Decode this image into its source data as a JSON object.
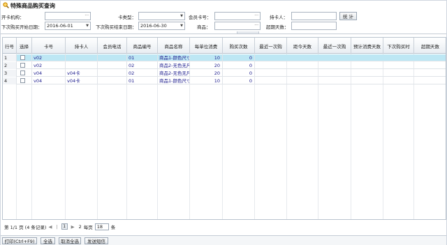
{
  "window": {
    "title": "特殊商品购买查询"
  },
  "filters": {
    "row1": [
      {
        "label": "开卡机构：",
        "value": ""
      },
      {
        "label": "卡类型：",
        "value": ""
      },
      {
        "label": "会员卡号：",
        "value": ""
      },
      {
        "label": "持卡人：",
        "value": ""
      }
    ],
    "row2": [
      {
        "label": "下次购买开始日期：",
        "value": "2016-06-01"
      },
      {
        "label": "下次购买结束日期：",
        "value": "2016-06-30"
      },
      {
        "label": "商品：",
        "value": ""
      },
      {
        "label": "超期天数：",
        "value": ""
      }
    ],
    "stat_button": "统 计"
  },
  "table": {
    "columns": [
      "行号",
      "选择",
      "卡号",
      "持卡人",
      "会员电话",
      "商品编号",
      "商品名称",
      "每单位消费",
      "购买次数",
      "最近一次购",
      "距今天数",
      "最近一次购",
      "预计消费天数",
      "下次购买时",
      "超期天数"
    ],
    "rows": [
      {
        "rn": "1",
        "card": "v02",
        "holder": "",
        "phone": "",
        "code": "01",
        "name": "商品1-颜色尺寸",
        "unit": "10",
        "times": "0"
      },
      {
        "rn": "2",
        "card": "v02",
        "holder": "",
        "phone": "",
        "code": "02",
        "name": "商品2-无色无尺",
        "unit": "20",
        "times": "0"
      },
      {
        "rn": "3",
        "card": "v04",
        "holder": "v04卡",
        "phone": "",
        "code": "02",
        "name": "商品2-无色无尺",
        "unit": "20",
        "times": "0"
      },
      {
        "rn": "4",
        "card": "v04",
        "holder": "v04卡",
        "phone": "",
        "code": "01",
        "name": "商品1-颜色尺寸",
        "unit": "10",
        "times": "0"
      }
    ]
  },
  "pager": {
    "summary": "第 1/1 页 (4 条记录)",
    "page": "1",
    "page_next": "2",
    "per_page_label": "每页",
    "per_page": "18",
    "per_page_unit": "条"
  },
  "footer": {
    "print": "打印(Ctrl+F9)",
    "select_all": "全选",
    "deselect_all": "取消全选",
    "send_sms": "发送短信"
  },
  "colors": {
    "selected_row": "#bde7f4",
    "link_text": "#1a1a8c"
  }
}
